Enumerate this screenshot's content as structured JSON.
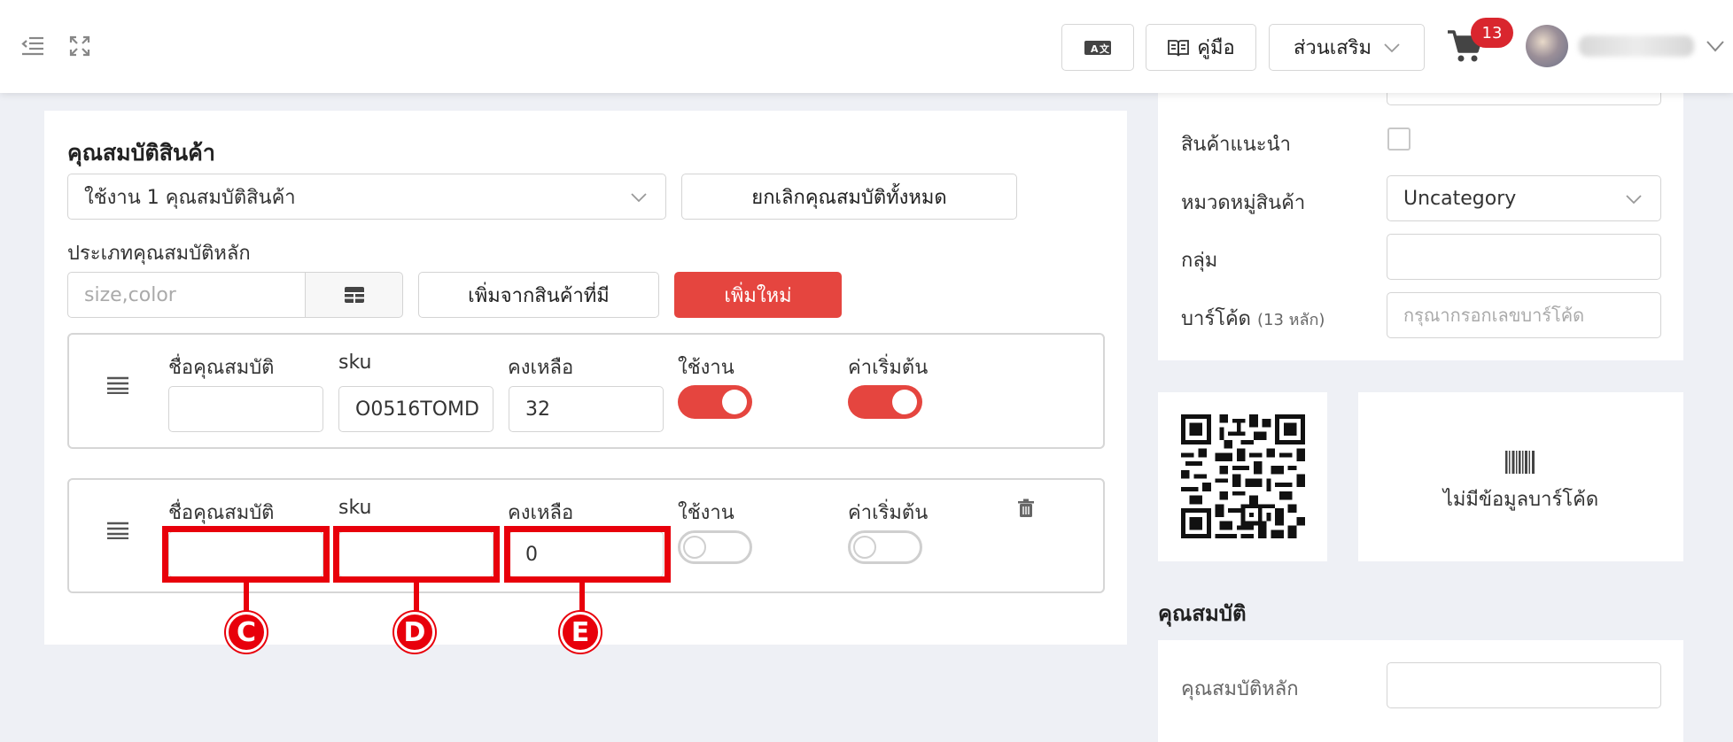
{
  "topbar": {
    "guide_label": "คู่มือ",
    "addons_label": "ส่วนเสริม",
    "cart_count": "13"
  },
  "attributes_card": {
    "title": "คุณสมบัติสินค้า",
    "usage_select": "ใช้งาน 1 คุณสมบัติสินค้า",
    "cancel_all_label": "ยกเลิกคุณสมบัติทั้งหมด",
    "main_type_label": "ประเภทคุณสมบัติหลัก",
    "main_type_placeholder": "size,color",
    "add_existing_label": "เพิ่มจากสินค้าที่มี",
    "add_new_label": "เพิ่มใหม่",
    "columns": {
      "name": "ชื่อคุณสมบัติ",
      "sku": "sku",
      "stock": "คงเหลือ",
      "active": "ใช้งาน",
      "default": "ค่าเริ่มต้น"
    },
    "rows": [
      {
        "name": "",
        "sku": "O0516TOMD",
        "stock": "32",
        "active": true,
        "default": true
      },
      {
        "name": "",
        "sku": "",
        "stock": "0",
        "active": false,
        "default": false
      }
    ]
  },
  "callouts": [
    "C",
    "D",
    "E"
  ],
  "side_panel": {
    "recommended_label": "สินค้าแนะนำ",
    "category_label": "หมวดหมู่สินค้า",
    "category_value": "Uncategory",
    "group_label": "กลุ่ม",
    "barcode_label": "บาร์โค้ด",
    "barcode_hint": "(13 หลัก)",
    "barcode_placeholder": "กรุณากรอกเลขบาร์โค้ด",
    "no_barcode_label": "ไม่มีข้อมูลบาร์โค้ด",
    "attributes_title": "คุณสมบัติ",
    "main_attribute_label": "คุณสมบัติหลัก"
  },
  "colors": {
    "accent": "#e5453f",
    "highlight": "#e8000b",
    "badge": "#d9262e"
  }
}
